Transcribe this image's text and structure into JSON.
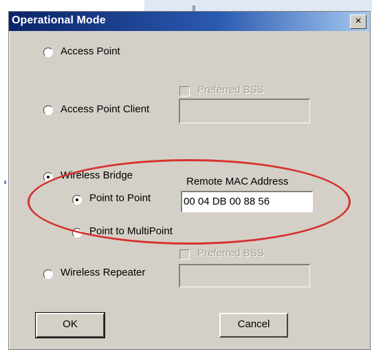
{
  "dialog": {
    "title": "Operational Mode",
    "close_symbol": "×"
  },
  "options": {
    "access_point": "Access Point",
    "access_point_client": "Access Point Client",
    "wireless_bridge": "Wireless Bridge",
    "point_to_point": "Point to Point",
    "point_to_multipoint": "Point to MultiPoint",
    "wireless_repeater": "Wireless Repeater"
  },
  "selected": {
    "mode": "Wireless Bridge",
    "bridge_type": "Point to Point"
  },
  "fields": {
    "preferred_bss_label": "Preferred BSS",
    "preferred_bss_value": "",
    "repeater_preferred_bss_value": "",
    "remote_mac_label": "Remote MAC Address",
    "remote_mac_value": "00 04 DB 00 88 56"
  },
  "buttons": {
    "ok": "OK",
    "cancel": "Cancel"
  },
  "icons": {
    "close": "close-icon",
    "radio": "radio-button",
    "checkbox": "checkbox"
  },
  "colors": {
    "titlebar_start": "#0a246a",
    "titlebar_end": "#a6caf0",
    "dialog_background": "#d4d0c8",
    "annotation": "#d6322f"
  }
}
